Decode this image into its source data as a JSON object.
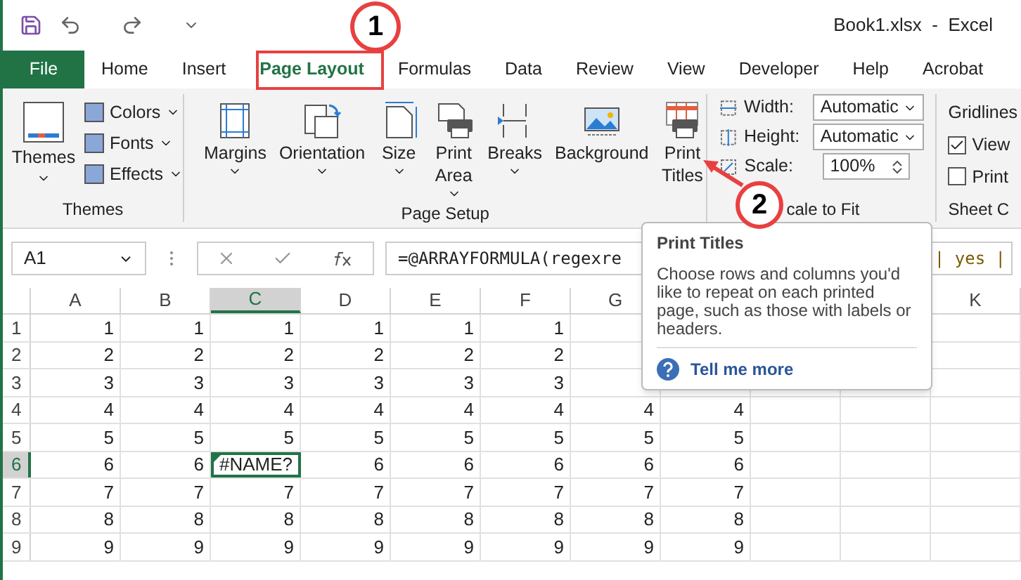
{
  "title_bar": {
    "title": "Book1.xlsx  -  Excel"
  },
  "tabs": [
    {
      "label": "File",
      "kind": "file",
      "selected": false
    },
    {
      "label": "Home",
      "kind": "tab",
      "selected": false
    },
    {
      "label": "Insert",
      "kind": "tab",
      "selected": false
    },
    {
      "label": "Page Layout",
      "kind": "tab",
      "selected": true
    },
    {
      "label": "Formulas",
      "kind": "tab",
      "selected": false
    },
    {
      "label": "Data",
      "kind": "tab",
      "selected": false
    },
    {
      "label": "Review",
      "kind": "tab",
      "selected": false
    },
    {
      "label": "View",
      "kind": "tab",
      "selected": false
    },
    {
      "label": "Developer",
      "kind": "tab",
      "selected": false
    },
    {
      "label": "Help",
      "kind": "tab",
      "selected": false
    },
    {
      "label": "Acrobat",
      "kind": "tab",
      "selected": false
    }
  ],
  "ribbon": {
    "themes": {
      "label": "Themes",
      "button": "Themes",
      "items": [
        "Colors",
        "Fonts",
        "Effects"
      ]
    },
    "page_setup": {
      "label": "Page Setup",
      "buttons": [
        {
          "label": "Margins",
          "kind": "margins"
        },
        {
          "label": "Orientation",
          "kind": "orientation"
        },
        {
          "label": "Size",
          "kind": "size"
        },
        {
          "label": "Print Area",
          "kind": "printarea"
        },
        {
          "label": "Breaks",
          "kind": "breaks"
        },
        {
          "label": "Background",
          "kind": "background"
        },
        {
          "label": "Print Titles",
          "kind": "printtitles"
        }
      ]
    },
    "scale_to_fit": {
      "label": "cale to Fit",
      "width_label": "Width:",
      "width_value": "Automatic",
      "height_label": "Height:",
      "height_value": "Automatic",
      "scale_label": "Scale:",
      "scale_value": "100%"
    },
    "sheet_options": {
      "label": "Sheet C",
      "heading": "Gridlines",
      "view": {
        "label": "View",
        "checked": true
      },
      "print": {
        "label": "Print",
        "checked": false
      }
    }
  },
  "formula_bar": {
    "name_box": "A1",
    "formula": "=@ARRAYFORMULA(regexre",
    "formula_tail": "| yes |"
  },
  "columns": [
    {
      "label": "A",
      "selected": false
    },
    {
      "label": "B",
      "selected": false
    },
    {
      "label": "C",
      "selected": true
    },
    {
      "label": "D",
      "selected": false
    },
    {
      "label": "E",
      "selected": false
    },
    {
      "label": "F",
      "selected": false
    },
    {
      "label": "G",
      "selected": false
    },
    {
      "label": "K",
      "selected": false
    }
  ],
  "rows": [
    {
      "label": "1",
      "selected": false,
      "cells": [
        "1",
        "1",
        "1",
        "1",
        "1",
        "1"
      ]
    },
    {
      "label": "2",
      "selected": false,
      "cells": [
        "2",
        "2",
        "2",
        "2",
        "2",
        "2"
      ]
    },
    {
      "label": "3",
      "selected": false,
      "cells": [
        "3",
        "3",
        "3",
        "3",
        "3",
        "3"
      ]
    },
    {
      "label": "4",
      "selected": false,
      "cells": [
        "4",
        "4",
        "4",
        "4",
        "4",
        "4",
        "4",
        "4"
      ]
    },
    {
      "label": "5",
      "selected": false,
      "cells": [
        "5",
        "5",
        "5",
        "5",
        "5",
        "5",
        "5",
        "5"
      ]
    },
    {
      "label": "6",
      "selected": true,
      "cells": [
        "6",
        "6",
        "#NAME?",
        "6",
        "6",
        "6",
        "6",
        "6"
      ]
    },
    {
      "label": "7",
      "selected": false,
      "cells": [
        "7",
        "7",
        "7",
        "7",
        "7",
        "7",
        "7",
        "7"
      ]
    },
    {
      "label": "8",
      "selected": false,
      "cells": [
        "8",
        "8",
        "8",
        "8",
        "8",
        "8",
        "8",
        "8"
      ]
    },
    {
      "label": "9",
      "selected": false,
      "cells": [
        "9",
        "9",
        "9",
        "9",
        "9",
        "9",
        "9",
        "9"
      ]
    }
  ],
  "tooltip": {
    "title": "Print Titles",
    "body": "Choose rows and columns you'd like to repeat on each printed page, such as those with labels or headers.",
    "link": "Tell me more"
  },
  "callouts": [
    "1",
    "2"
  ]
}
